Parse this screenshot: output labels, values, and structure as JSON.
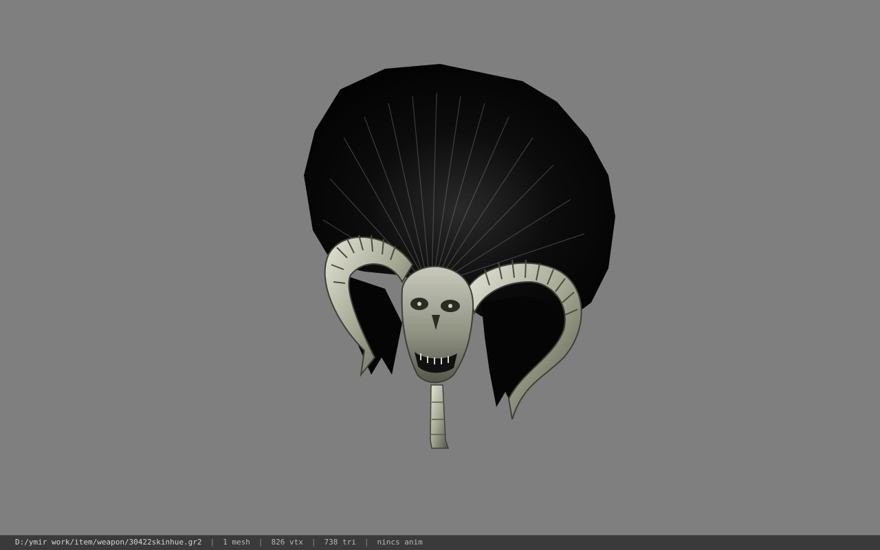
{
  "viewer": {
    "background_color": "#7f7f7f",
    "model_preview": "skull-ram-horn-weapon-ornament"
  },
  "status": {
    "file_path": "D:/ymir work/item/weapon/30422skinhue.gr2",
    "mesh_count": "1 mesh",
    "vertex_count": "826 vtx",
    "triangle_count": "738 tri",
    "anim_state": "nincs anim",
    "separator": "|"
  }
}
